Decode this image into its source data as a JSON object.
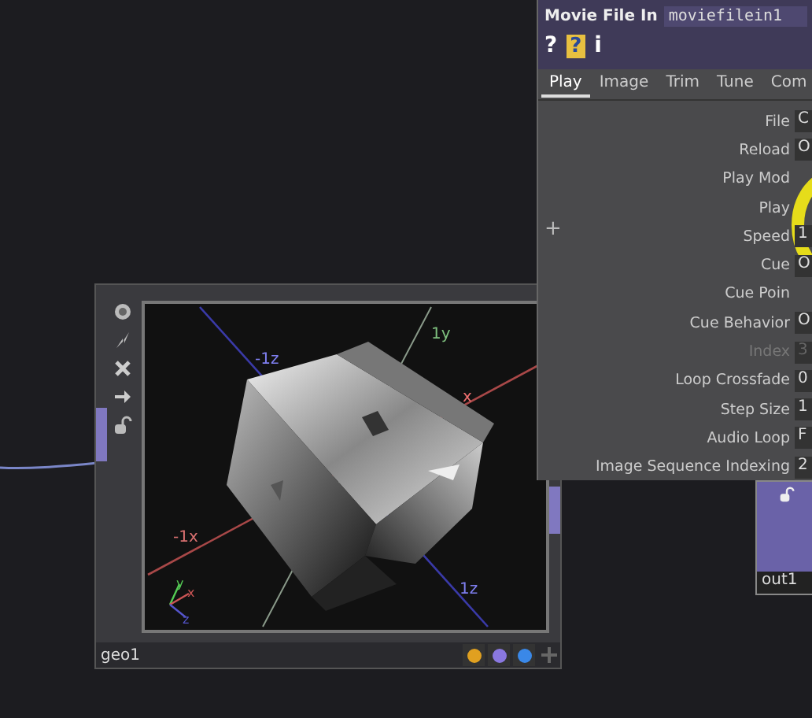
{
  "panel": {
    "title": "Movie File In",
    "name": "moviefilein1",
    "icons": [
      {
        "kind": "help",
        "text": "?"
      },
      {
        "kind": "python-help",
        "text": "?"
      },
      {
        "kind": "info",
        "text": "i"
      }
    ],
    "tabs": [
      {
        "label": "Play",
        "selected": true
      },
      {
        "label": "Image",
        "selected": false
      },
      {
        "label": "Trim",
        "selected": false
      },
      {
        "label": "Tune",
        "selected": false
      },
      {
        "label": "Com",
        "selected": false
      }
    ],
    "add": "+",
    "params": [
      {
        "label": "File",
        "value": "C",
        "disabled": false
      },
      {
        "label": "Reload",
        "value": "O",
        "disabled": false
      },
      {
        "label": "Play Mod",
        "disabled": false
      },
      {
        "label": "Play",
        "disabled": false
      },
      {
        "label": "Speed",
        "value": "1",
        "disabled": false
      },
      {
        "label": "Cue",
        "value": "O",
        "disabled": false
      },
      {
        "label": "Cue Poin",
        "disabled": false
      },
      {
        "label": "Cue Behavior",
        "value": "O",
        "disabled": false
      },
      {
        "label": "Index",
        "value": "3",
        "disabled": true
      },
      {
        "label": "Loop Crossfade",
        "value": "0",
        "disabled": false
      },
      {
        "label": "Step Size",
        "value": "1",
        "disabled": false
      },
      {
        "label": "Audio Loop",
        "value": "F",
        "disabled": false
      },
      {
        "label": "Image Sequence Indexing",
        "value": "2",
        "disabled": false
      }
    ]
  },
  "geo_node": {
    "name": "geo1",
    "axis_labels": [
      "-1z",
      "1y",
      "x",
      "-1x",
      "1z"
    ],
    "gizmo_labels": [
      "y",
      "x",
      "z"
    ],
    "flags": [
      {
        "color": "#e0a020"
      },
      {
        "color": "#8a78e0"
      },
      {
        "color": "#3a88e8"
      }
    ]
  },
  "out_node": {
    "name": "out1"
  }
}
